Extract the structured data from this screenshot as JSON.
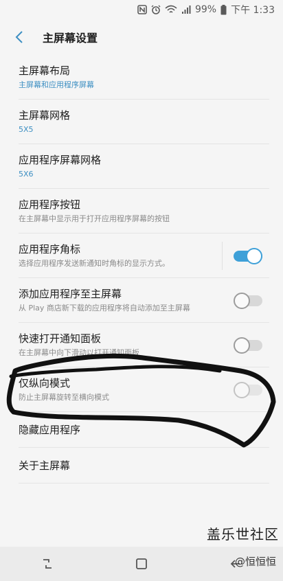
{
  "status_bar": {
    "battery": "99%",
    "time": "下午 1:33"
  },
  "header": {
    "title": "主屏幕设置"
  },
  "settings": [
    {
      "label": "主屏幕布局",
      "sub": "主屏幕和应用程序屏幕"
    },
    {
      "label": "主屏幕网格",
      "sub": "5X5"
    },
    {
      "label": "应用程序屏幕网格",
      "sub": "5X6"
    },
    {
      "label": "应用程序按钮",
      "sub": "在主屏幕中显示用于打开应用程序屏幕的按钮"
    },
    {
      "label": "应用程序角标",
      "sub": "选择应用程序发送新通知时角标的显示方式。",
      "toggle": "on"
    },
    {
      "label": "添加应用程序至主屏幕",
      "sub": "从 Play 商店新下载的应用程序将自动添加至主屏幕",
      "toggle": "off"
    },
    {
      "label": "快速打开通知面板",
      "sub": "在主屏幕中向下滑动以打开通知面板",
      "toggle": "off"
    },
    {
      "label": "仅纵向模式",
      "sub": "防止主屏幕旋转至横向模式",
      "toggle": "off"
    },
    {
      "label": "隐藏应用程序"
    },
    {
      "label": "关于主屏幕"
    }
  ],
  "watermark": {
    "line1": "盖乐世社区",
    "line2": "@恒恒恒"
  },
  "colors": {
    "accent": "#3ea0d8",
    "subtitle_blue": "#3d8fc2",
    "background": "#f5f5f5"
  },
  "icons": {
    "back": "chevron-left-icon",
    "recent": "recent-apps-icon",
    "home": "home-icon",
    "nav_back": "back-arrow-icon"
  }
}
